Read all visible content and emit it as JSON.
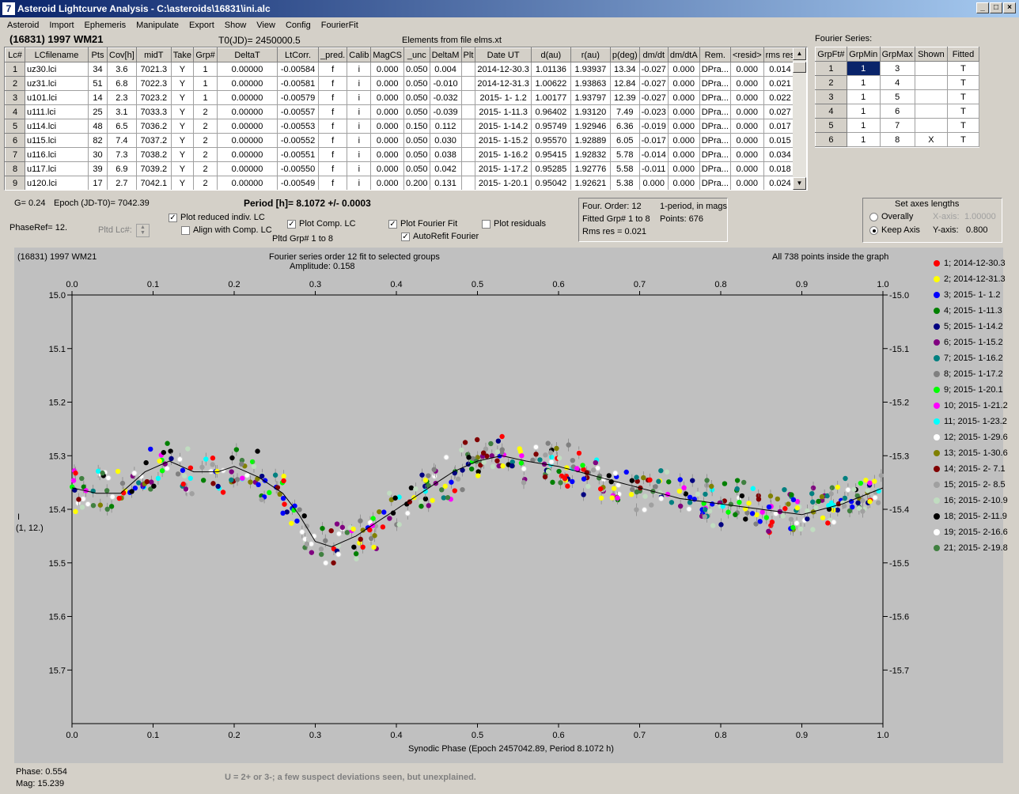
{
  "window": {
    "title": "Asteroid Lightcurve Analysis - C:\\asteroids\\16831\\ini.alc",
    "min": "_",
    "max": "□",
    "close": "×",
    "icon": "7"
  },
  "menu": [
    "Asteroid",
    "Import",
    "Ephemeris",
    "Manipulate",
    "Export",
    "Show",
    "View",
    "Config",
    "FourierFit"
  ],
  "header": {
    "asteroid": "(16831) 1997 WM21",
    "t0": "T0(JD)= 2450000.5",
    "elements": "Elements from file elms.xt",
    "fourier_series": "Fourier Series:"
  },
  "lc_table": {
    "columns": [
      "Lc#",
      "LCfilename",
      "Pts",
      "Cov[h]",
      "midT",
      "Take",
      "Grp#",
      "DeltaT",
      "LtCorr.",
      "_pred.",
      "Calib",
      "MagCS",
      "_unc",
      "DeltaM",
      "Plt",
      "Date UT",
      "d(au)",
      "r(au)",
      "p(deg)",
      "dm/dt",
      "dm/dtA",
      "Rem.",
      "<resid>",
      "rms res"
    ],
    "rows": [
      [
        "1",
        "uz30.lci",
        "34",
        "3.6",
        "7021.3",
        "Y",
        "1",
        "0.00000",
        "-0.00584",
        "f",
        "i",
        "0.000",
        "0.050",
        "0.004",
        "",
        "2014-12-30.3",
        "1.01136",
        "1.93937",
        "13.34",
        "-0.027",
        "0.000",
        "DPra...",
        "0.000",
        "0.014"
      ],
      [
        "2",
        "uz31.lci",
        "51",
        "6.8",
        "7022.3",
        "Y",
        "1",
        "0.00000",
        "-0.00581",
        "f",
        "i",
        "0.000",
        "0.050",
        "-0.010",
        "",
        "2014-12-31.3",
        "1.00622",
        "1.93863",
        "12.84",
        "-0.027",
        "0.000",
        "DPra...",
        "0.000",
        "0.021"
      ],
      [
        "3",
        "u101.lci",
        "14",
        "2.3",
        "7023.2",
        "Y",
        "1",
        "0.00000",
        "-0.00579",
        "f",
        "i",
        "0.000",
        "0.050",
        "-0.032",
        "",
        "2015- 1- 1.2",
        "1.00177",
        "1.93797",
        "12.39",
        "-0.027",
        "0.000",
        "DPra...",
        "0.000",
        "0.022"
      ],
      [
        "4",
        "u111.lci",
        "25",
        "3.1",
        "7033.3",
        "Y",
        "2",
        "0.00000",
        "-0.00557",
        "f",
        "i",
        "0.000",
        "0.050",
        "-0.039",
        "",
        "2015- 1-11.3",
        "0.96402",
        "1.93120",
        "7.49",
        "-0.023",
        "0.000",
        "DPra...",
        "0.000",
        "0.027"
      ],
      [
        "5",
        "u114.lci",
        "48",
        "6.5",
        "7036.2",
        "Y",
        "2",
        "0.00000",
        "-0.00553",
        "f",
        "i",
        "0.000",
        "0.150",
        "0.112",
        "",
        "2015- 1-14.2",
        "0.95749",
        "1.92946",
        "6.36",
        "-0.019",
        "0.000",
        "DPra...",
        "0.000",
        "0.017"
      ],
      [
        "6",
        "u115.lci",
        "82",
        "7.4",
        "7037.2",
        "Y",
        "2",
        "0.00000",
        "-0.00552",
        "f",
        "i",
        "0.000",
        "0.050",
        "0.030",
        "",
        "2015- 1-15.2",
        "0.95570",
        "1.92889",
        "6.05",
        "-0.017",
        "0.000",
        "DPra...",
        "0.000",
        "0.015"
      ],
      [
        "7",
        "u116.lci",
        "30",
        "7.3",
        "7038.2",
        "Y",
        "2",
        "0.00000",
        "-0.00551",
        "f",
        "i",
        "0.000",
        "0.050",
        "0.038",
        "",
        "2015- 1-16.2",
        "0.95415",
        "1.92832",
        "5.78",
        "-0.014",
        "0.000",
        "DPra...",
        "0.000",
        "0.034"
      ],
      [
        "8",
        "u117.lci",
        "39",
        "6.9",
        "7039.2",
        "Y",
        "2",
        "0.00000",
        "-0.00550",
        "f",
        "i",
        "0.000",
        "0.050",
        "0.042",
        "",
        "2015- 1-17.2",
        "0.95285",
        "1.92776",
        "5.58",
        "-0.011",
        "0.000",
        "DPra...",
        "0.000",
        "0.018"
      ],
      [
        "9",
        "u120.lci",
        "17",
        "2.7",
        "7042.1",
        "Y",
        "2",
        "0.00000",
        "-0.00549",
        "f",
        "i",
        "0.000",
        "0.200",
        "0.131",
        "",
        "2015- 1-20.1",
        "0.95042",
        "1.92621",
        "5.38",
        "0.000",
        "0.000",
        "DPra...",
        "0.000",
        "0.024"
      ]
    ]
  },
  "fourier_table": {
    "columns": [
      "GrpFt#",
      "GrpMin",
      "GrpMax",
      "Shown",
      "Fitted"
    ],
    "rows": [
      [
        "1",
        "1",
        "3",
        "",
        "T"
      ],
      [
        "2",
        "1",
        "4",
        "",
        "T"
      ],
      [
        "3",
        "1",
        "5",
        "",
        "T"
      ],
      [
        "4",
        "1",
        "6",
        "",
        "T"
      ],
      [
        "5",
        "1",
        "7",
        "",
        "T"
      ],
      [
        "6",
        "1",
        "8",
        "X",
        "T"
      ]
    ]
  },
  "controls": {
    "g": "G= 0.24",
    "epoch": "Epoch (JD-T0)= 7042.39",
    "period": "Period [h]= 8.1072 +/- 0.0003",
    "phaseref": "PhaseRef= 12.",
    "pltd_lc": "Pltd Lc#:",
    "cb_reduced": "Plot reduced indiv. LC",
    "cb_align": "Align with Comp. LC",
    "cb_comp": "Plot Comp. LC",
    "pltd_grp": "Pltd Grp#  1   to   8",
    "cb_fourier": "Plot Fourier Fit",
    "cb_autorefit": "AutoRefit Fourier",
    "cb_resid": "Plot residuals",
    "info1": "Four. Order: 12",
    "info2": "1-period, in mags",
    "info3": "Fitted Grp# 1 to 8",
    "info4": "Points: 676",
    "info5": "Rms res     = 0.021",
    "axes_title": "Set axes lengths",
    "r_overall": "Overally",
    "r_keep": "Keep Axis",
    "xaxis_lbl": "X-axis:",
    "xaxis_val": "1.00000",
    "yaxis_lbl": "Y-axis:",
    "yaxis_val": "0.800"
  },
  "plot": {
    "top_left": "(16831) 1997 WM21",
    "top_center": "Fourier series order 12 fit to selected groups",
    "amplitude": "Amplitude: 0.158",
    "top_right": "All 738 points inside the graph",
    "ylabel1": "I",
    "ylabel2": "(1, 12.)",
    "xlabel": "Synodic Phase (Epoch 2457042.89, Period 8.1072 h)"
  },
  "status": {
    "phase": "Phase:  0.554",
    "mag": "Mag:   15.239",
    "note": "U = 2+ or 3-; a few suspect deviations seen, but unexplained."
  },
  "chart_data": {
    "type": "scatter",
    "xlim": [
      0,
      1.0
    ],
    "ylim": [
      15.8,
      15.0
    ],
    "y_inverted": true,
    "xticks": [
      "0.0",
      "0.1",
      "0.2",
      "0.3",
      "0.4",
      "0.5",
      "0.6",
      "0.7",
      "0.8",
      "0.9",
      "1.0"
    ],
    "yticks": [
      "15.0",
      "15.1",
      "15.2",
      "15.3",
      "15.4",
      "15.5",
      "15.6",
      "15.7"
    ],
    "legend": [
      {
        "label": "1; 2014-12-30.3",
        "color": "#ff0000"
      },
      {
        "label": "2; 2014-12-31.3",
        "color": "#ffff00"
      },
      {
        "label": "3; 2015- 1- 1.2",
        "color": "#0000ff"
      },
      {
        "label": "4; 2015- 1-11.3",
        "color": "#008000"
      },
      {
        "label": "5; 2015- 1-14.2",
        "color": "#000080"
      },
      {
        "label": "6; 2015- 1-15.2",
        "color": "#800080"
      },
      {
        "label": "7; 2015- 1-16.2",
        "color": "#008080"
      },
      {
        "label": "8; 2015- 1-17.2",
        "color": "#808080"
      },
      {
        "label": "9; 2015- 1-20.1",
        "color": "#00ff00"
      },
      {
        "label": "10; 2015- 1-21.2",
        "color": "#ff00ff"
      },
      {
        "label": "11; 2015- 1-23.2",
        "color": "#00ffff"
      },
      {
        "label": "12; 2015- 1-29.6",
        "color": "#ffffff"
      },
      {
        "label": "13; 2015- 1-30.6",
        "color": "#808000"
      },
      {
        "label": "14; 2015- 2- 7.1",
        "color": "#800000"
      },
      {
        "label": "15; 2015- 2- 8.5",
        "color": "#a0a0a0"
      },
      {
        "label": "16; 2015- 2-10.9",
        "color": "#c0dcc0"
      },
      {
        "label": "18; 2015- 2-11.9",
        "color": "#000000"
      },
      {
        "label": "19; 2015- 2-16.6",
        "color": "#ffffff"
      },
      {
        "label": "21; 2015- 2-19.8",
        "color": "#408040"
      }
    ],
    "fourier_fit": {
      "x": [
        0,
        0.03,
        0.06,
        0.09,
        0.12,
        0.15,
        0.18,
        0.2,
        0.23,
        0.26,
        0.28,
        0.3,
        0.32,
        0.35,
        0.38,
        0.41,
        0.44,
        0.47,
        0.5,
        0.53,
        0.56,
        0.6,
        0.65,
        0.7,
        0.75,
        0.8,
        0.85,
        0.9,
        0.95,
        1.0
      ],
      "y": [
        15.36,
        15.37,
        15.37,
        15.33,
        15.31,
        15.33,
        15.33,
        15.32,
        15.34,
        15.37,
        15.41,
        15.46,
        15.47,
        15.45,
        15.42,
        15.39,
        15.36,
        15.33,
        15.31,
        15.3,
        15.31,
        15.32,
        15.34,
        15.36,
        15.38,
        15.39,
        15.4,
        15.41,
        15.39,
        15.36
      ]
    },
    "points_summary": "676 fitted points (groups 1-8) plus groups 9-21 scattered around the fit"
  }
}
